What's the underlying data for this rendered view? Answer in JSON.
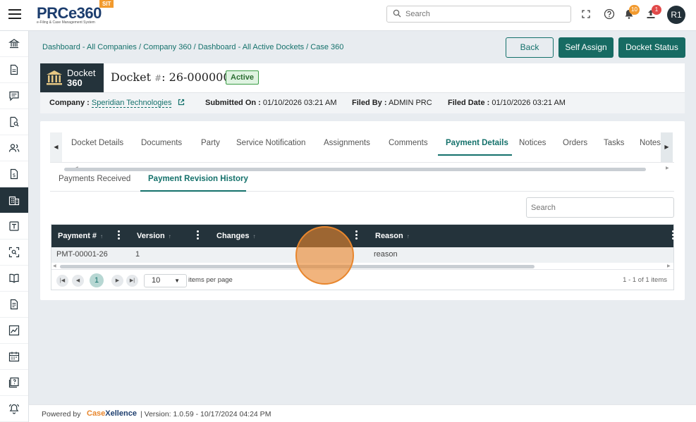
{
  "app": {
    "logo_text": "PRCe360",
    "logo_tagline": "e-Filing & Case Management System",
    "env_badge": "SIT"
  },
  "header": {
    "search_placeholder": "Search",
    "notifications_count": "10",
    "uploads_count": "1",
    "avatar_initials": "R1",
    "badge_colors": {
      "notifications": "#f29a2e",
      "uploads": "#e14a4a"
    }
  },
  "sidebar": {
    "items": [
      {
        "icon": "institution-icon"
      },
      {
        "icon": "document-icon"
      },
      {
        "icon": "chat-icon"
      },
      {
        "icon": "document-search-icon"
      },
      {
        "icon": "users-icon"
      },
      {
        "icon": "dollar-document-icon"
      },
      {
        "icon": "building-icon",
        "active": true
      },
      {
        "icon": "template-icon"
      },
      {
        "icon": "scan-icon"
      },
      {
        "icon": "book-icon"
      },
      {
        "icon": "file-list-icon"
      },
      {
        "icon": "chart-icon"
      },
      {
        "icon": "calendar-icon"
      },
      {
        "icon": "help-document-icon"
      },
      {
        "icon": "bell-ring-icon"
      }
    ]
  },
  "breadcrumb": "Dashboard - All Companies / Company 360 / Dashboard - All Active Dockets / Case 360",
  "actions": {
    "back": "Back",
    "self_assign": "Self Assign",
    "docket_status": "Docket Status"
  },
  "docket": {
    "logo_line1": "Docket",
    "logo_line2": "360",
    "title_prefix": "Docket",
    "title_hash": "#",
    "title_number": ": 26-0000001",
    "status": "Active"
  },
  "meta": {
    "company_label": "Company :",
    "company_value": "Speridian Technologies",
    "submitted_label": "Submitted On :",
    "submitted_value": "01/10/2026 03:21 AM",
    "filed_by_label": "Filed By :",
    "filed_by_value": "ADMIN PRC",
    "filed_date_label": "Filed Date :",
    "filed_date_value": "01/10/2026 03:21 AM"
  },
  "tabs": [
    "Docket Details",
    "Documents",
    "Party",
    "Service Notification",
    "Assignments",
    "Comments",
    "Payment Details",
    "Notices",
    "Orders",
    "Tasks",
    "Notes"
  ],
  "active_tab": "Payment Details",
  "subtabs": [
    "Payments Received",
    "Payment Revision History"
  ],
  "active_subtab": "Payment Revision History",
  "grid": {
    "search_placeholder": "Search",
    "columns": [
      "Payment #",
      "Version",
      "Changes",
      "Reason"
    ],
    "rows": [
      {
        "payment": "PMT-00001-26",
        "version": "1",
        "changes": "",
        "reason": "reason"
      }
    ],
    "pager": {
      "current_page": "1",
      "page_size": "10",
      "items_per_page_label": "items per page",
      "info": "1 - 1 of 1 items"
    }
  },
  "footer": {
    "powered_by": "Powered by",
    "brand_part1": "Case",
    "brand_part2": "Xellence",
    "version": "|  Version: 1.0.59 - 10/17/2024 04:24 PM"
  }
}
